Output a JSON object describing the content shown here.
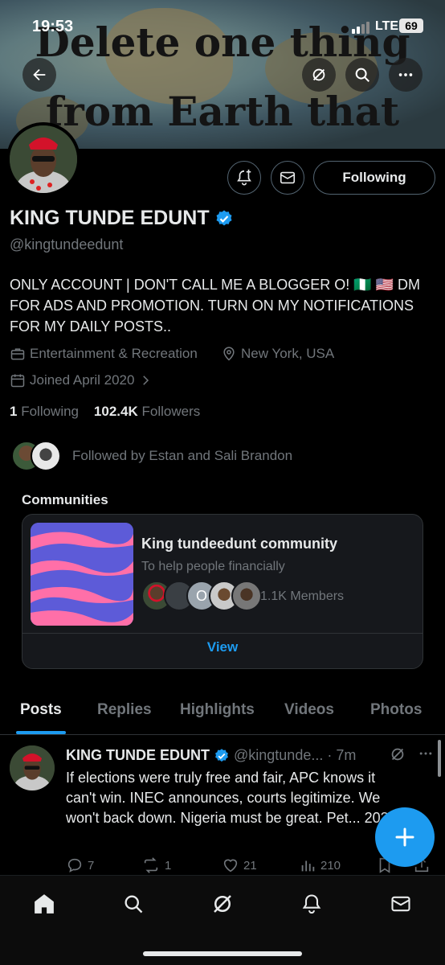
{
  "status_bar": {
    "time": "19:53",
    "network": "LTE",
    "battery": "69"
  },
  "banner": {
    "line1": "Delete one thing",
    "line2": "from Earth that"
  },
  "profile": {
    "follow_label": "Following",
    "name": "KING TUNDE EDUNT",
    "handle": "@kingtundeedunt",
    "bio": "ONLY ACCOUNT | DON'T CALL ME A BLOGGER O! 🇳🇬 🇺🇸 DM FOR ADS AND PROMOTION. TURN ON MY NOTIFICATIONS FOR MY DAILY POSTS..",
    "category": "Entertainment & Recreation",
    "location": "New York, USA",
    "joined": "Joined April 2020",
    "following_count": "1",
    "following_label": "Following",
    "followers_count": "102.4K",
    "followers_label": "Followers",
    "followed_by": "Followed by Estan and Sali Brandon"
  },
  "communities": {
    "title": "Communities",
    "name": "King tundeedunt community",
    "description": "To help people financially",
    "members": "1.1K Members",
    "avatar_letter": "O",
    "view_label": "View"
  },
  "tabs": [
    {
      "label": "Posts",
      "active": true
    },
    {
      "label": "Replies",
      "active": false
    },
    {
      "label": "Highlights",
      "active": false
    },
    {
      "label": "Videos",
      "active": false
    },
    {
      "label": "Photos",
      "active": false
    }
  ],
  "post": {
    "name": "KING TUNDE EDUNT",
    "handle": "@kingtunde...",
    "time": "· 7m",
    "text": "If elections were truly free and fair, APC knows it can't win. INEC announces, courts legitimize. We won't back down. Nigeria must be great. Pet... 2027.",
    "replies": "7",
    "reposts": "1",
    "likes": "21",
    "views": "210"
  },
  "colors": {
    "accent": "#1d9bf0",
    "muted": "#71767b",
    "border": "#2f3336"
  },
  "icons": [
    "back-arrow-icon",
    "grok-icon",
    "search-icon",
    "more-icon",
    "bell-plus-icon",
    "mail-icon",
    "verified-icon",
    "briefcase-icon",
    "location-icon",
    "calendar-icon",
    "chevron-right-icon",
    "reply-icon",
    "repost-icon",
    "like-icon",
    "views-icon",
    "bookmark-icon",
    "share-icon",
    "plus-icon",
    "home-icon",
    "bell-icon"
  ]
}
